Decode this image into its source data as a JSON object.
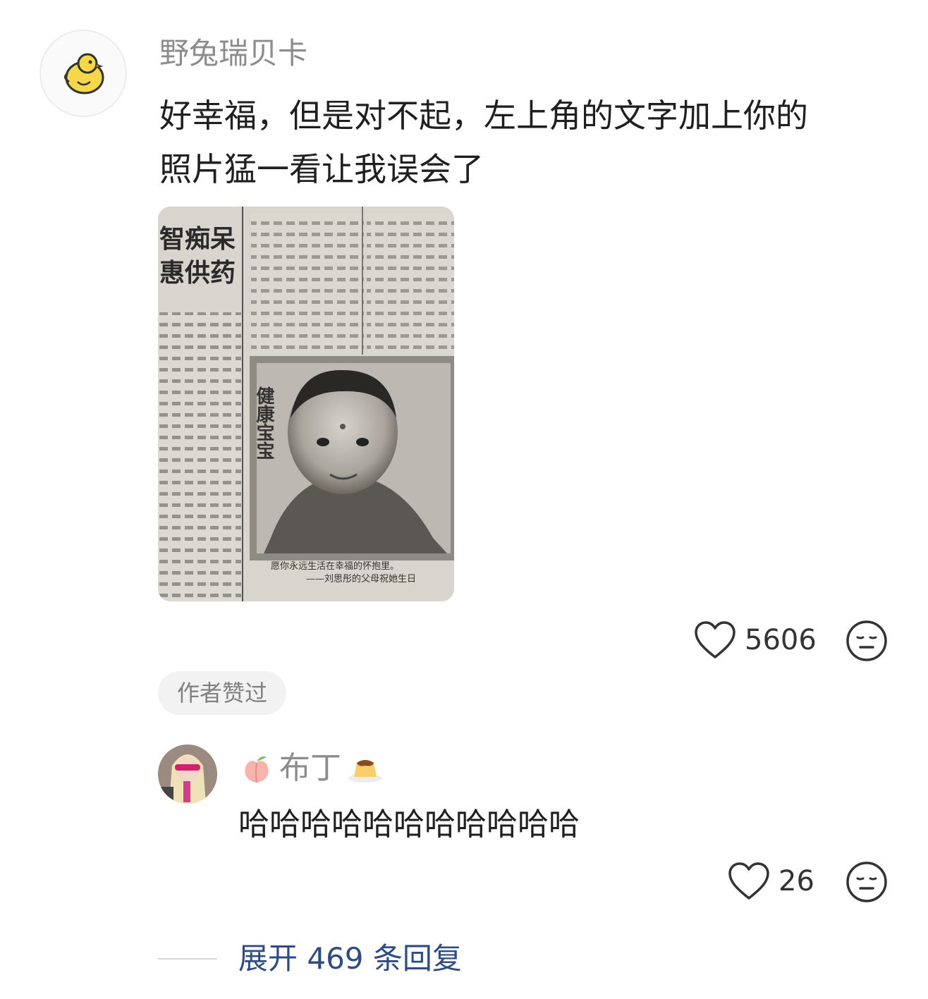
{
  "comment": {
    "username": "野兔瑞贝卡",
    "text": "好幸福，但是对不起，左上角的文字加上你的照片猛一看让我误会了",
    "likes": "5606",
    "avatar_icon": "yellow-chick-icon",
    "photo": {
      "headline_top": "智痴呆",
      "headline_second": "惠供药",
      "headline_vertical": "健康宝宝",
      "caption_line1": "愿你永远生活在幸福的怀抱里。",
      "caption_line2": "——刘思彤的父母祝她生日"
    }
  },
  "author_liked_badge": "作者赞过",
  "reply": {
    "username": "布丁",
    "prefix_emoji": "peach-emoji",
    "suffix_emoji": "pudding-emoji",
    "text": "哈哈哈哈哈哈哈哈哈哈哈",
    "likes": "26"
  },
  "expand_replies": "展开 469 条回复",
  "colors": {
    "link": "#2f4b84",
    "muted": "#8c8c8c",
    "text": "#1f1f1f"
  }
}
